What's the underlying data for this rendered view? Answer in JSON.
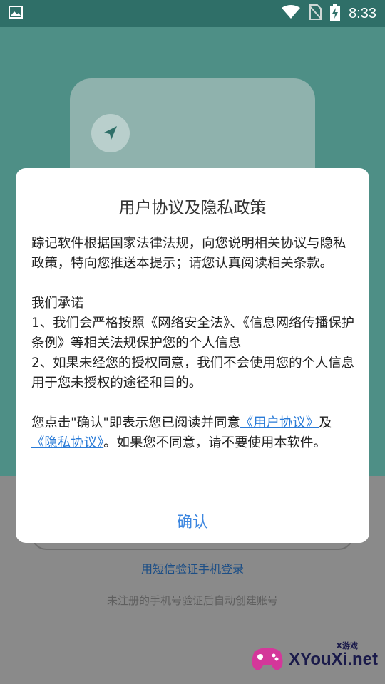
{
  "status_bar": {
    "time": "8:33",
    "icons": [
      "image-icon",
      "wifi-icon",
      "no-sim-icon",
      "battery-charging-icon"
    ]
  },
  "background": {
    "sms_login_link": "用短信验证手机登录",
    "hint": "未注册的手机号验证后自动创建账号"
  },
  "watermark": {
    "text": "XYouXi.net",
    "small": "X游戏"
  },
  "dialog": {
    "title": "用户协议及隐私政策",
    "intro": "踪记软件根据国家法律法规，向您说明相关协议与隐私政策，特向您推送本提示；请您认真阅读相关条款。",
    "promise_heading": "我们承诺",
    "promise_1": "1、我们会严格按照《网络安全法》、《信息网络传播保护条例》等相关法规保护您的个人信息",
    "promise_2": "2、如果未经您的授权同意，我们不会使用您的个人信息用于您未授权的途径和目的。",
    "consent_prefix": "您点击\"确认\"即表示您已阅读并同意",
    "user_agreement_link": "《用户协议》",
    "consent_and": "及",
    "privacy_link": "《隐私协议》",
    "consent_suffix": "。如果您不同意，请不要使用本软件。",
    "confirm_label": "确认"
  },
  "colors": {
    "accent": "#3d87e0",
    "link": "#2a7bd7",
    "status_bar": "#2f6f68",
    "hero": "#4e8f86"
  }
}
